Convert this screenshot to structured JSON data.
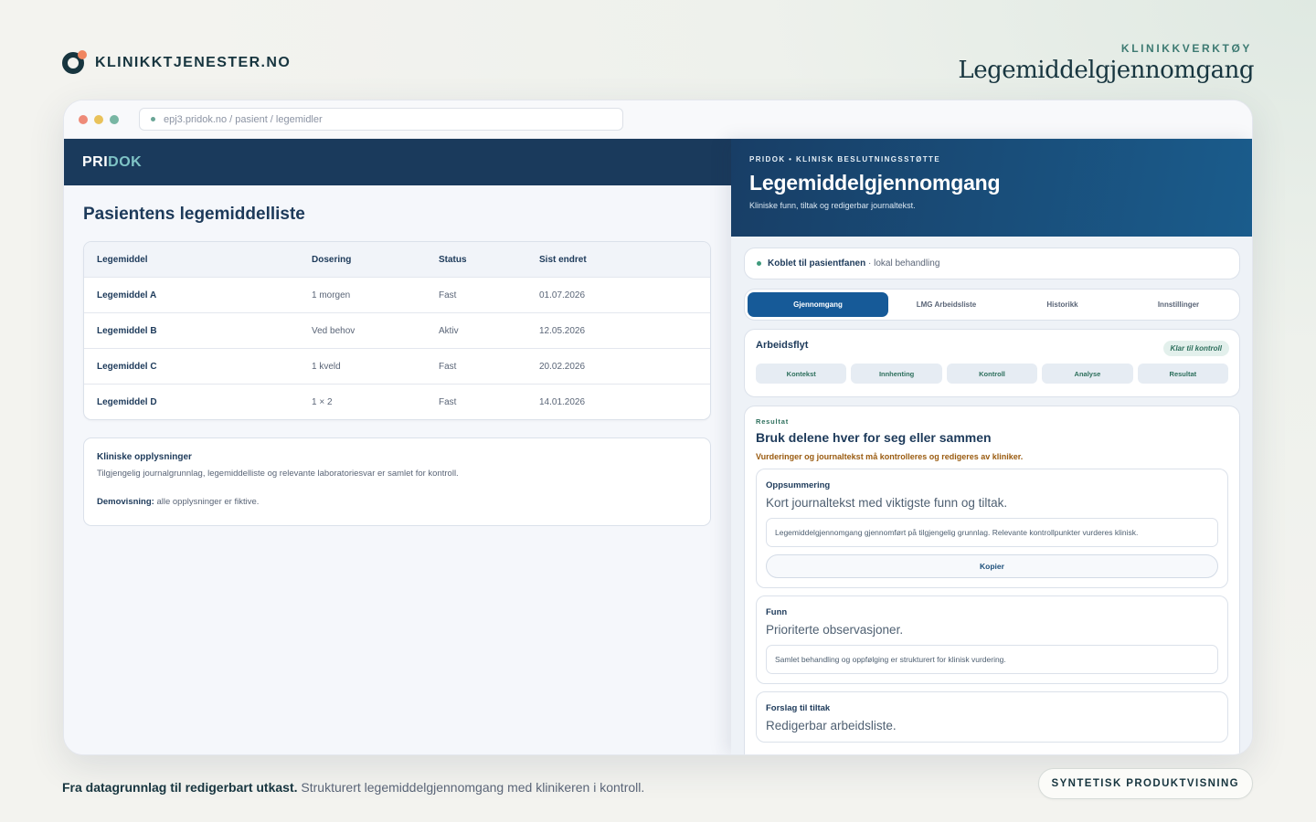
{
  "brand": {
    "name": "KLINIKKTJENESTER.NO"
  },
  "hero": {
    "kicker": "KLINIKKVERKTØY",
    "title": "Legemiddelgjennomgang"
  },
  "browser": {
    "url": "epj3.pridok.no / pasient / legemidler"
  },
  "app": {
    "logo_a": "PRI",
    "logo_b": "DOK"
  },
  "left": {
    "title": "Pasientens legemiddelliste",
    "columns": [
      "Legemiddel",
      "Dosering",
      "Status",
      "Sist endret"
    ],
    "rows": [
      [
        "Legemiddel A",
        "1 morgen",
        "Fast",
        "01.07.2026"
      ],
      [
        "Legemiddel B",
        "Ved behov",
        "Aktiv",
        "12.05.2026"
      ],
      [
        "Legemiddel C",
        "1 kveld",
        "Fast",
        "20.02.2026"
      ],
      [
        "Legemiddel D",
        "1 × 2",
        "Fast",
        "14.01.2026"
      ]
    ],
    "info": {
      "title": "Kliniske opplysninger",
      "text": "Tilgjengelig journalgrunnlag, legemiddelliste og relevante laboratoriesvar er samlet for kontroll.",
      "demo_label": "Demovisning:",
      "demo_text": " alle opplysninger er fiktive."
    }
  },
  "panel": {
    "kicker": "PRIDOK • KLINISK BESLUTNINGSSTØTTE",
    "title": "Legemiddelgjennomgang",
    "subtitle": "Kliniske funn, tiltak og redigerbar journaltekst.",
    "status_bold": "Koblet til pasientfanen",
    "status_rest": " · lokal behandling",
    "tabs": [
      "Gjennomgang",
      "LMG Arbeidsliste",
      "Historikk",
      "Innstillinger"
    ],
    "workflow": {
      "title": "Arbeidsflyt",
      "badge": "Klar til kontroll",
      "steps": [
        "Kontekst",
        "Innhenting",
        "Kontroll",
        "Analyse",
        "Resultat"
      ]
    },
    "result": {
      "kicker": "Resultat",
      "title": "Bruk delene hver for seg eller sammen",
      "warning": "Vurderinger og journaltekst må kontrolleres og redigeres av kliniker.",
      "sections": [
        {
          "title": "Oppsummering",
          "lead": "Kort journaltekst med viktigste funn og tiltak.",
          "box": "Legemiddelgjennomgang gjennomført på tilgjengelig grunnlag. Relevante kontrollpunkter vurderes klinisk.",
          "button": "Kopier"
        },
        {
          "title": "Funn",
          "lead": "Prioriterte observasjoner.",
          "box": "Samlet behandling og oppfølging er strukturert for klinisk vurdering."
        },
        {
          "title": "Forslag til tiltak",
          "lead": "Redigerbar arbeidsliste."
        }
      ]
    }
  },
  "footer": {
    "bold": "Fra datagrunnlag til redigerbart utkast.",
    "text": " Strukturert legemiddelgjennomgang med klinikeren i kontroll.",
    "pill": "SYNTETISK PRODUKTVISNING"
  }
}
